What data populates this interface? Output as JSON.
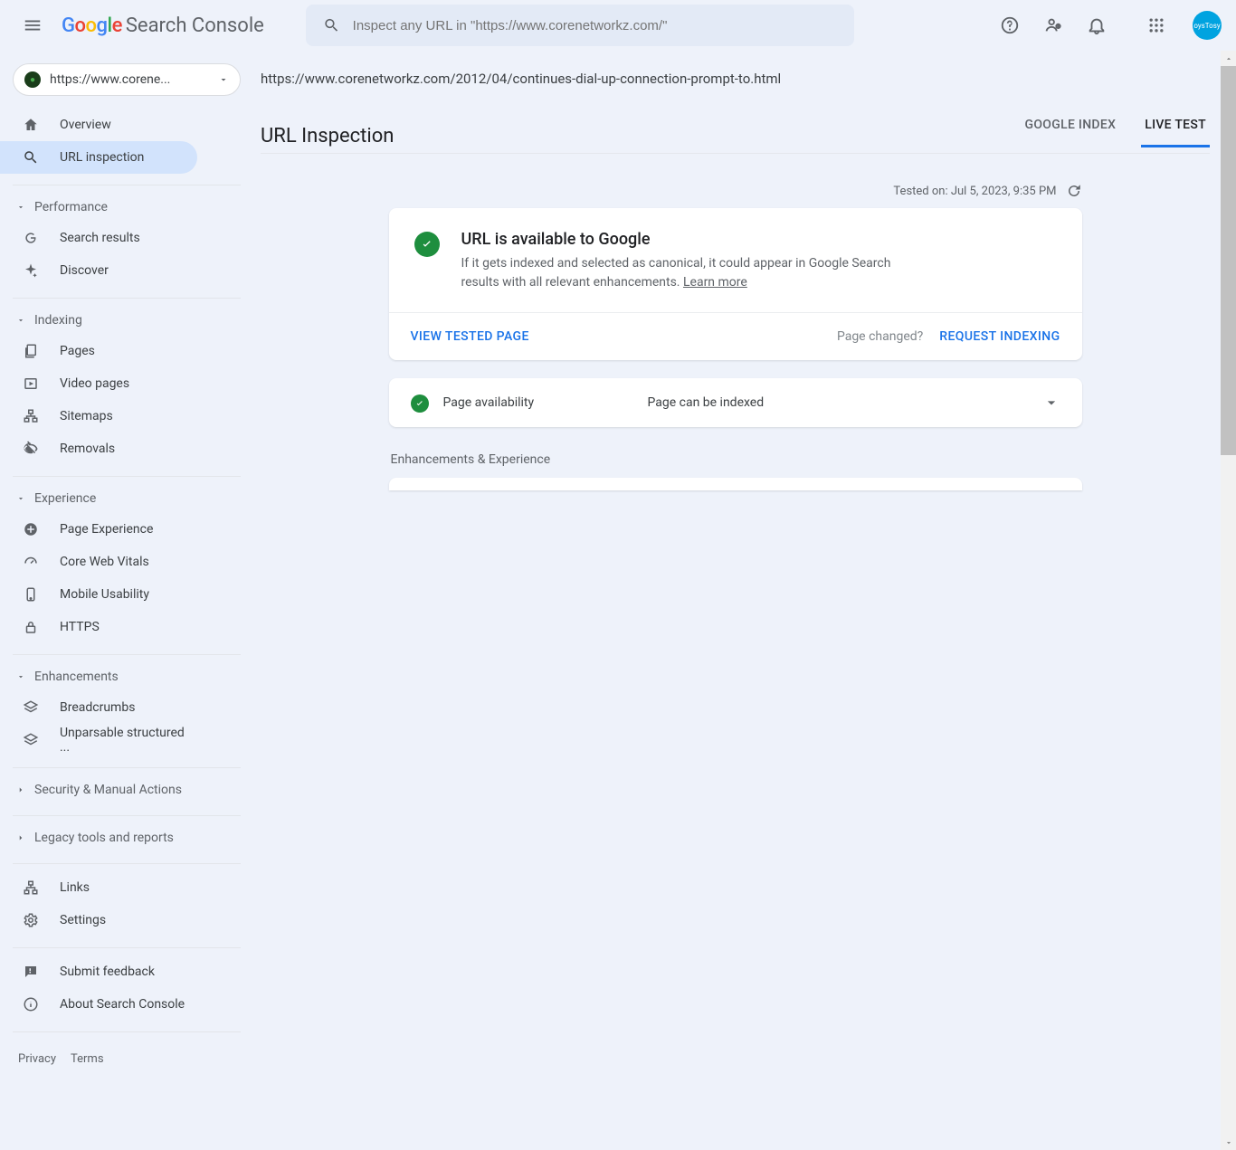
{
  "brand": {
    "name": "Google",
    "product": "Search Console"
  },
  "search": {
    "placeholder": "Inspect any URL in \"https://www.corenetworkz.com/\""
  },
  "avatar_text": "oysTosy",
  "property_selector": {
    "label": "https://www.corene..."
  },
  "nav": {
    "overview": "Overview",
    "url_inspection": "URL inspection",
    "groups": {
      "performance": "Performance",
      "indexing": "Indexing",
      "experience": "Experience",
      "enhancements": "Enhancements",
      "security": "Security & Manual Actions",
      "legacy": "Legacy tools and reports"
    },
    "performance": {
      "search_results": "Search results",
      "discover": "Discover"
    },
    "indexing": {
      "pages": "Pages",
      "video_pages": "Video pages",
      "sitemaps": "Sitemaps",
      "removals": "Removals"
    },
    "experience": {
      "page_exp": "Page Experience",
      "cwv": "Core Web Vitals",
      "mobile": "Mobile Usability",
      "https": "HTTPS"
    },
    "enhancements": {
      "breadcrumbs": "Breadcrumbs",
      "unparsable": "Unparsable structured ..."
    },
    "links": "Links",
    "settings": "Settings",
    "feedback": "Submit feedback",
    "about": "About Search Console"
  },
  "footer": {
    "privacy": "Privacy",
    "terms": "Terms"
  },
  "main": {
    "url": "https://www.corenetworkz.com/2012/04/continues-dial-up-connection-prompt-to.html",
    "title": "URL Inspection",
    "tabs": {
      "index": "GOOGLE INDEX",
      "live": "LIVE TEST"
    },
    "tested_on_prefix": "Tested on: ",
    "tested_on_value": "Jul 5, 2023, 9:35 PM",
    "status": {
      "title": "URL is available to Google",
      "desc": "If it gets indexed and selected as canonical, it could appear in Google Search results with all relevant enhancements. ",
      "learn_more": "Learn more"
    },
    "actions": {
      "view_tested": "VIEW TESTED PAGE",
      "page_changed": "Page changed?",
      "request_indexing": "REQUEST INDEXING"
    },
    "page_avail": {
      "key": "Page availability",
      "value": "Page can be indexed"
    },
    "enhancements_section": "Enhancements & Experience"
  }
}
